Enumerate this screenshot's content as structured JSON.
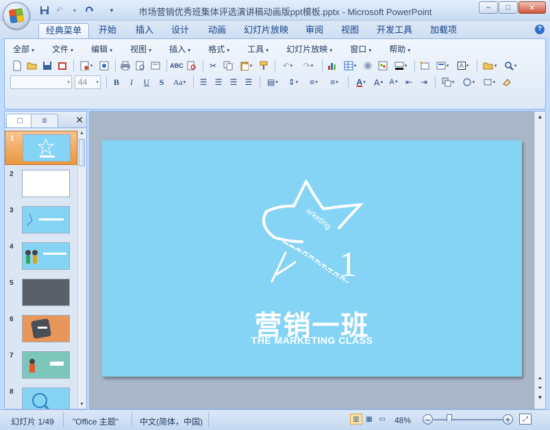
{
  "window": {
    "title": "市场营销优秀班集体评选演讲稿动画版ppt模板.pptx - Microsoft PowerPoint",
    "controls": [
      "–",
      "□",
      "✕"
    ]
  },
  "qat": {
    "save_icon": "save-icon",
    "undo_icon": "undo-icon",
    "redo_icon": "redo-icon",
    "customize_icon": "customize-icon"
  },
  "tabs": [
    {
      "label": "经典菜单",
      "active": true
    },
    {
      "label": "开始"
    },
    {
      "label": "插入"
    },
    {
      "label": "设计"
    },
    {
      "label": "动画"
    },
    {
      "label": "幻灯片放映"
    },
    {
      "label": "审阅"
    },
    {
      "label": "视图"
    },
    {
      "label": "开发工具"
    },
    {
      "label": "加载项"
    }
  ],
  "help_icon": "?",
  "menus": [
    "全部",
    "文件",
    "编辑",
    "视图",
    "插入",
    "格式",
    "工具",
    "幻灯片放映",
    "窗口",
    "帮助"
  ],
  "font": {
    "family_value": "",
    "size_value": "44"
  },
  "slides": [
    {
      "num": "1",
      "selected": true
    },
    {
      "num": "2"
    },
    {
      "num": "3"
    },
    {
      "num": "4"
    },
    {
      "num": "5"
    },
    {
      "num": "6"
    },
    {
      "num": "7"
    },
    {
      "num": "8"
    }
  ],
  "slide": {
    "logo_text": "arketing",
    "logo_number": "1",
    "title": "营销一班",
    "subtitle": "THE MARKETING CLASS",
    "background": "#86d4f5"
  },
  "status": {
    "slide_info": "幻灯片 1/49",
    "theme": "\"Office 主题\"",
    "language": "中文(简体，中国)",
    "zoom": "48%",
    "zoom_fraction": 0.48
  },
  "colors": {
    "ribbon_blue": "#15428b",
    "selected_slide": "#e9973d",
    "slide_bg": "#86d4f5"
  }
}
